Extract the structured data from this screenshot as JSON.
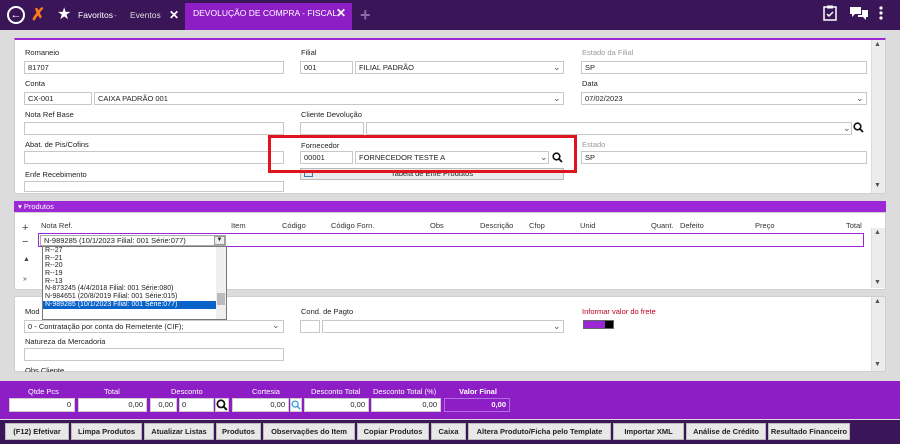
{
  "topbar": {
    "favoritos": "Favoritos",
    "separator": "-",
    "tab_eventos": "Eventos",
    "tab_close": "✕",
    "tab_active": "DEVOLUÇÃO DE COMPRA - FISCAL",
    "add_tab": "+"
  },
  "form": {
    "romaneio_label": "Romaneio",
    "romaneio_value": "81707",
    "filial_label": "Filial",
    "filial_code": "001",
    "filial_name": "FILIAL PADRÃO",
    "estado_filial_label": "Estado da Filial",
    "estado_filial_value": "SP",
    "conta_label": "Conta",
    "conta_code": "CX-001",
    "conta_name": "CAIXA PADRÃO 001",
    "data_label": "Data",
    "data_value": "07/02/2023",
    "nota_ref_base_label": "Nota Ref Base",
    "nota_ref_base_value": "",
    "cliente_devolucao_label": "Cliente Devolução",
    "abat_label": "Abat. de Pis/Cofins",
    "fornecedor_label": "Fornecedor",
    "fornecedor_code": "00001",
    "fornecedor_name": "FORNECEDOR TESTE A",
    "estado_label": "Estado",
    "estado_value": "SP",
    "enfe_label": "Enfe Recebimento",
    "tabela_button": "Tabela de Enfe Produtos"
  },
  "produtos": {
    "section_label": "Produtos",
    "columns": [
      "Nota Ref.",
      "Item",
      "Código",
      "Código Forn.",
      "Obs",
      "Descrição",
      "Cfop",
      "Unid",
      "Quant.",
      "Defeito",
      "Preço",
      "Total"
    ],
    "row1_nota": "N-989285 (10/1/2023 Filial: 001 Série:077)",
    "side_plus": "+",
    "side_minus": "−",
    "dropdown_options": [
      "R--27",
      "R--21",
      "R--20",
      "R--19",
      "R--13",
      "N-873245 (4/4/2018 Filial: 001 Série:080)",
      "N-984651 (20/8/2019 Filial: 001 Série:015)",
      "N-989285 (10/1/2023 Filial: 001 Série:077)"
    ],
    "dropdown_selected_index": 7
  },
  "bottom": {
    "modalidade_label": "Mod",
    "modalidade_value": "0 - Contratação por conta do Remetente (CIF);",
    "cond_pagto_label": "Cond. de Pagto",
    "frete_label": "Informar valor do frete",
    "natureza_label": "Natureza da Mercadoria",
    "obs_cliente_label": "Obs Cliente"
  },
  "totals": {
    "qtde_pcs_label": "Qtde Pcs",
    "qtde_pcs_value": "0",
    "total_label": "Total",
    "total_value": "0,00",
    "desconto_label": "Desconto",
    "desconto_value1": "0,00",
    "desconto_value2": "0",
    "cortesia_label": "Cortesia",
    "cortesia_value": "0,00",
    "desconto_total_label": "Desconto Total",
    "desconto_total_value": "0,00",
    "desconto_total_pct_label": "Desconto Total (%)",
    "desconto_total_pct_value": "0,00",
    "valor_final_label": "Valor Final",
    "valor_final_value": "0,00"
  },
  "actions": [
    "(F12) Efetivar",
    "Limpa Produtos",
    "Atualizar Listas",
    "Produtos",
    "Observações do Item",
    "Copiar Produtos",
    "Caixa",
    "Altera Produto/Ficha pelo Template",
    "Importar XML",
    "Análise de Crédito",
    "Resultado Financeiro"
  ],
  "colors": {
    "accent": "#9b27d6",
    "topbar": "#3a1659",
    "highlight": "#e0141e",
    "selected": "#0a63c9"
  }
}
